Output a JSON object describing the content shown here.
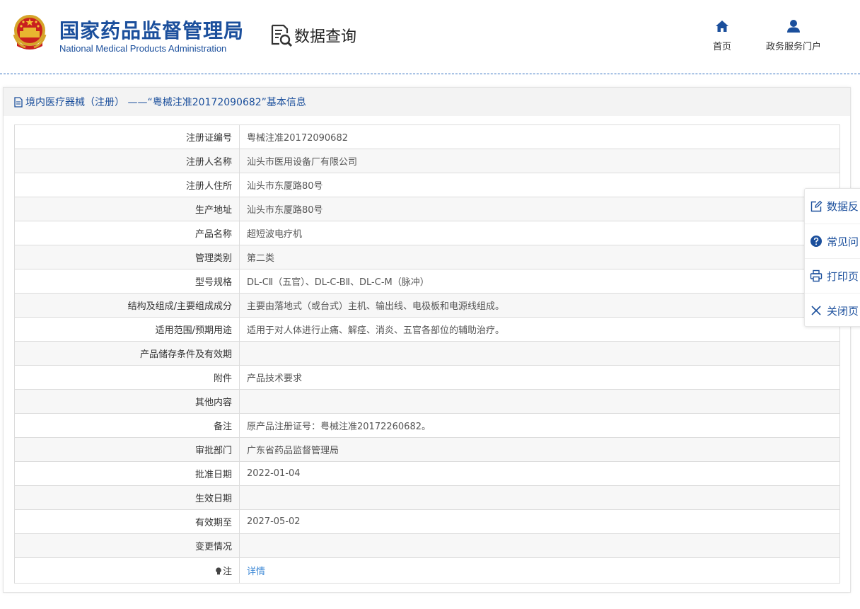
{
  "header": {
    "org_name_cn": "国家药品监督管理局",
    "org_name_en": "National Medical Products Administration",
    "section_title": "数据查询",
    "nav": [
      {
        "label": "首页",
        "icon": "home-icon"
      },
      {
        "label": "政务服务门户",
        "icon": "user-icon"
      }
    ]
  },
  "panel": {
    "title": "境内医疗器械（注册） ——“粤械注准20172090682”基本信息",
    "rows": [
      {
        "label": "注册证编号",
        "value": "粤械注准20172090682"
      },
      {
        "label": "注册人名称",
        "value": "汕头市医用设备厂有限公司"
      },
      {
        "label": "注册人住所",
        "value": "汕头市东厦路80号"
      },
      {
        "label": "生产地址",
        "value": "汕头市东厦路80号"
      },
      {
        "label": "产品名称",
        "value": "超短波电疗机"
      },
      {
        "label": "管理类别",
        "value": "第二类"
      },
      {
        "label": "型号规格",
        "value": "DL-CⅡ（五官）、DL-C-BⅡ、DL-C-M（脉冲）"
      },
      {
        "label": "结构及组成/主要组成成分",
        "value": "主要由落地式（或台式）主机、输出线、电极板和电源线组成。"
      },
      {
        "label": "适用范围/预期用途",
        "value": "适用于对人体进行止痛、解痉、消炎、五官各部位的辅助治疗。"
      },
      {
        "label": "产品储存条件及有效期",
        "value": ""
      },
      {
        "label": "附件",
        "value": "产品技术要求"
      },
      {
        "label": "其他内容",
        "value": ""
      },
      {
        "label": "备注",
        "value": "原产品注册证号：粤械注准20172260682。"
      },
      {
        "label": "审批部门",
        "value": "广东省药品监督管理局"
      },
      {
        "label": "批准日期",
        "value": "2022-01-04"
      },
      {
        "label": "生效日期",
        "value": ""
      },
      {
        "label": "有效期至",
        "value": "2027-05-02"
      },
      {
        "label": "变更情况",
        "value": ""
      }
    ],
    "note_row": {
      "label": "注",
      "link": "详情"
    }
  },
  "sidebar": [
    {
      "label": "数据反",
      "icon": "edit-icon"
    },
    {
      "label": "常见问",
      "icon": "question-icon"
    },
    {
      "label": "打印页",
      "icon": "print-icon"
    },
    {
      "label": "关闭页",
      "icon": "close-icon"
    }
  ],
  "colors": {
    "brand": "#1b4f9c",
    "link": "#3c88d6",
    "header_line": "#2f6fc1"
  }
}
